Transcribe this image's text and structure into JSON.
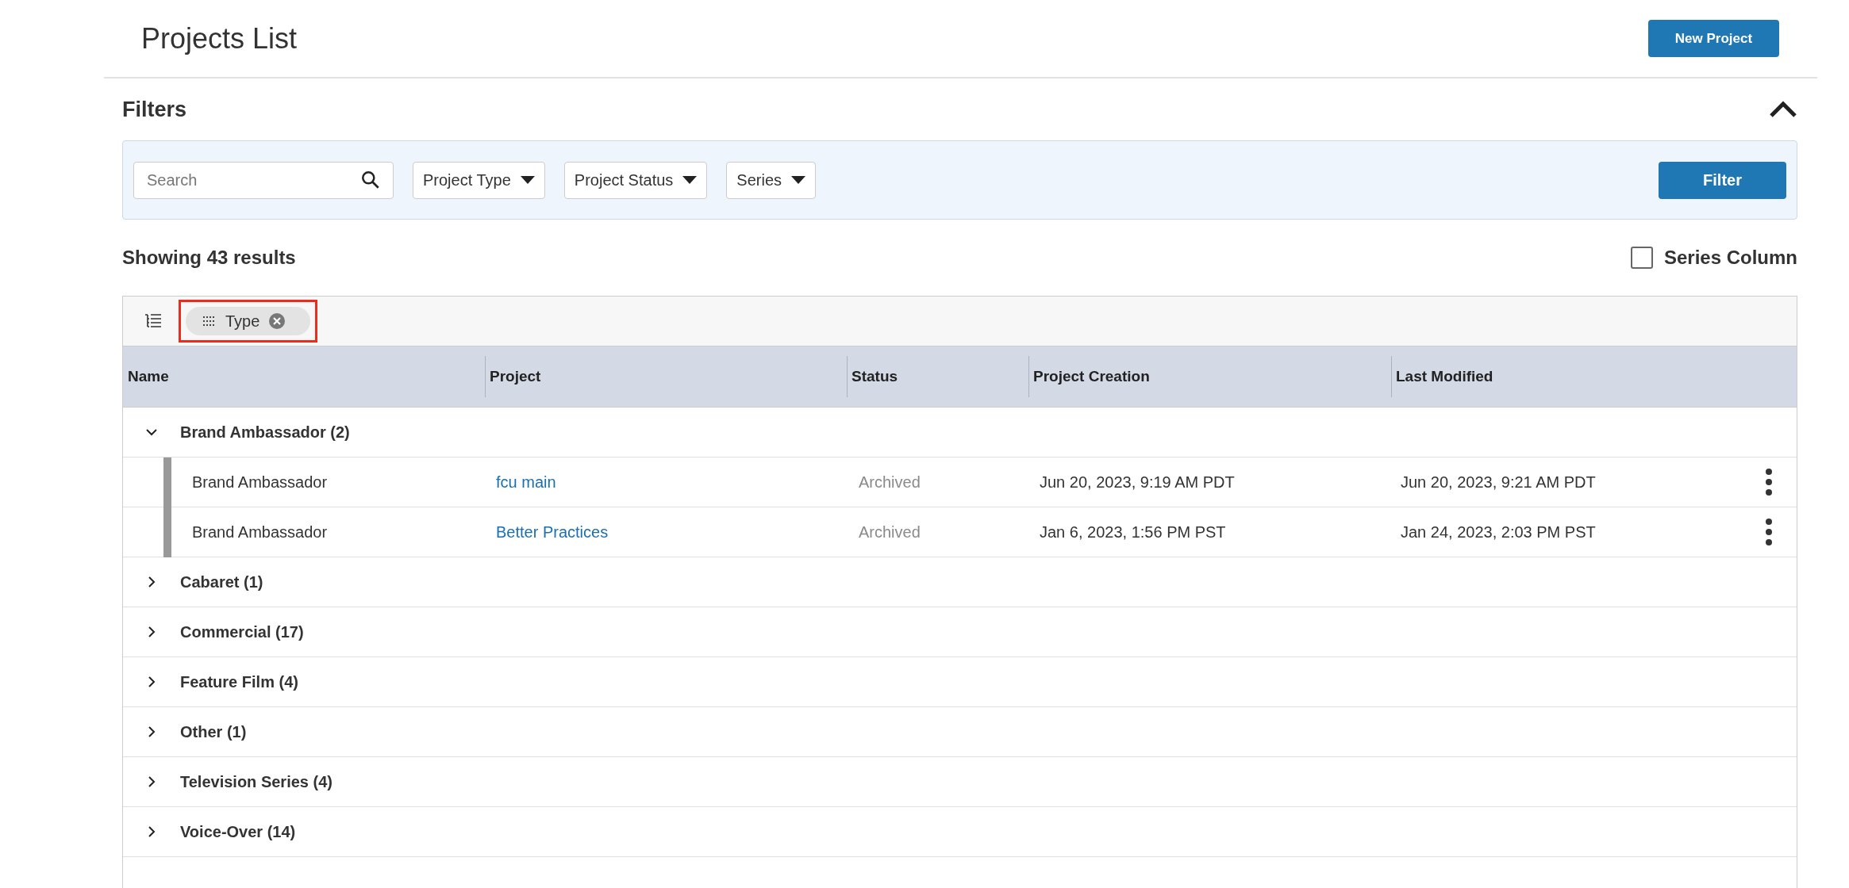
{
  "header": {
    "title": "Projects List",
    "new_button": "New Project"
  },
  "filters": {
    "title": "Filters",
    "expanded": true,
    "search": {
      "placeholder": "Search"
    },
    "dropdowns": [
      "Project Type",
      "Project Status",
      "Series"
    ],
    "filter_button": "Filter"
  },
  "results": {
    "count_text": "Showing 43 results",
    "series_column": {
      "label": "Series Column",
      "checked": false
    }
  },
  "table": {
    "group_chips": [
      {
        "label": "Type",
        "highlighted": true
      }
    ],
    "columns": [
      "Name",
      "Project",
      "Status",
      "Project Creation",
      "Last Modified"
    ],
    "groups": [
      {
        "label": "Brand Ambassador (2)",
        "expanded": true,
        "rows": [
          {
            "name": "Brand Ambassador",
            "project": "fcu main",
            "status": "Archived",
            "created": "Jun 20, 2023, 9:19 AM PDT",
            "modified": "Jun 20, 2023, 9:21 AM PDT"
          },
          {
            "name": "Brand Ambassador",
            "project": "Better Practices",
            "status": "Archived",
            "created": "Jan 6, 2023, 1:56 PM PST",
            "modified": "Jan 24, 2023, 2:03 PM PST"
          }
        ]
      },
      {
        "label": "Cabaret (1)",
        "expanded": false
      },
      {
        "label": "Commercial (17)",
        "expanded": false
      },
      {
        "label": "Feature Film (4)",
        "expanded": false
      },
      {
        "label": "Other (1)",
        "expanded": false
      },
      {
        "label": "Television Series (4)",
        "expanded": false
      },
      {
        "label": "Voice-Over (14)",
        "expanded": false
      }
    ]
  }
}
